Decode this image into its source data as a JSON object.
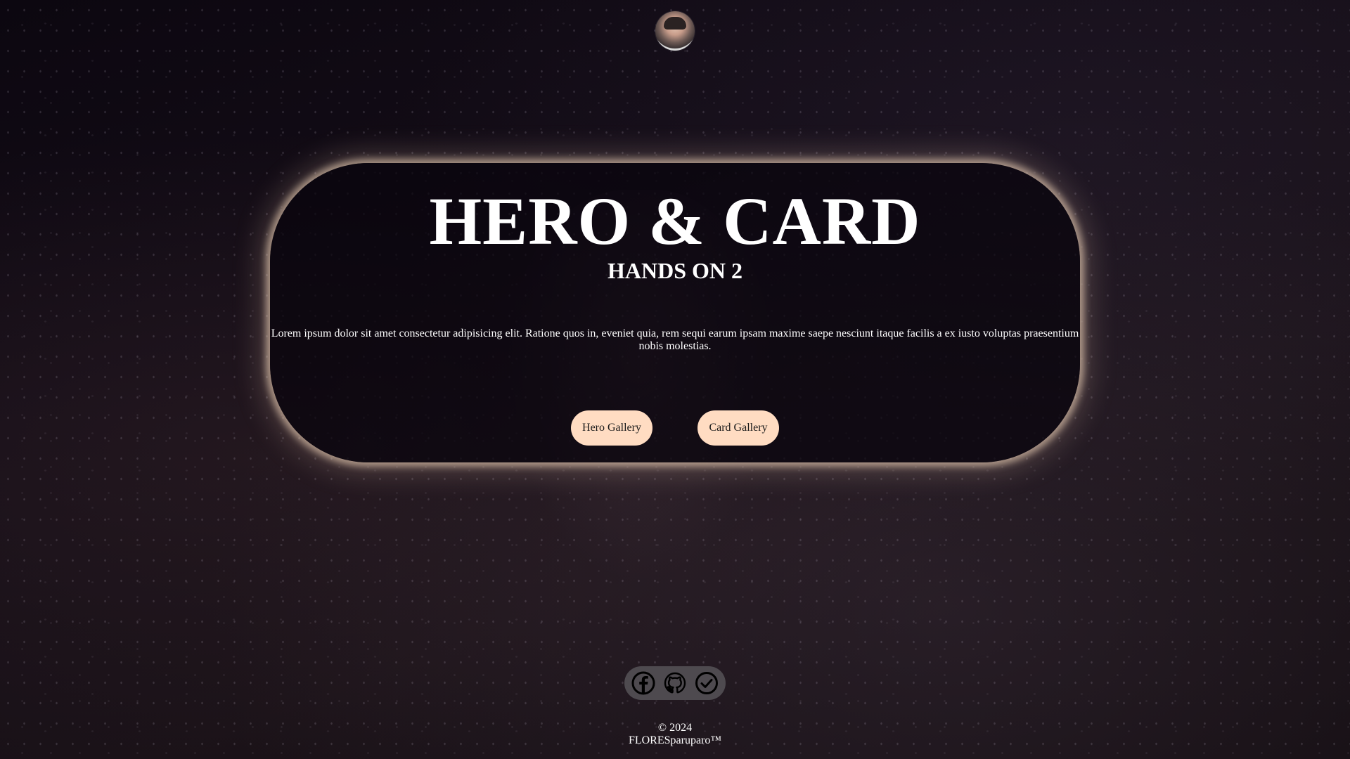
{
  "header": {
    "avatar_alt": "profile avatar"
  },
  "hero": {
    "title": "HERO & CARD",
    "subtitle": "HANDS ON 2",
    "description": "Lorem ipsum dolor sit amet consectetur adipisicing elit. Ratione quos in, eveniet quia, rem sequi earum ipsam maxime saepe nesciunt itaque facilis a ex iusto voluptas praesentium nobis molestias.",
    "buttons": {
      "hero_gallery": "Hero Gallery",
      "card_gallery": "Card Gallery"
    }
  },
  "socials": [
    {
      "icon": "facebook-icon"
    },
    {
      "icon": "github-icon"
    },
    {
      "icon": "check-circle-icon"
    }
  ],
  "footer": {
    "copyright": "© 2024",
    "brand": "FLORESparuparo™"
  },
  "colors": {
    "button_bg": "#ffdcc2",
    "card_glow": "#ffe1c4",
    "social_bar": "#4e4a4f"
  }
}
